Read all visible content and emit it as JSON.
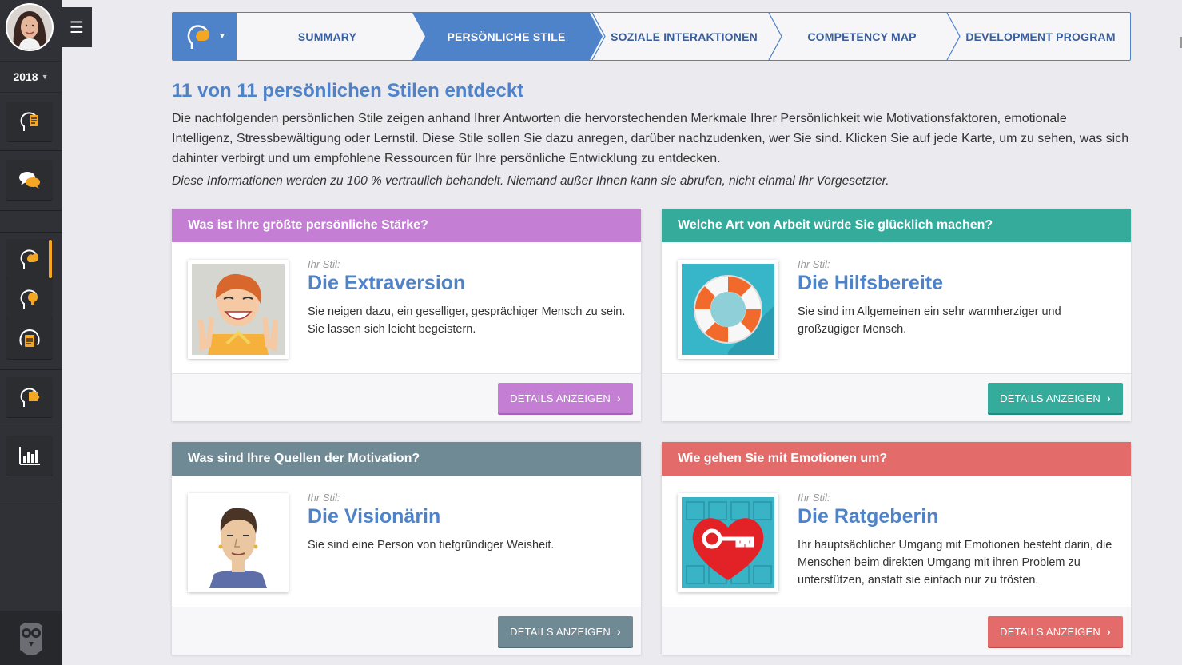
{
  "sidebar": {
    "year": "2018",
    "icons": [
      "head-document-icon",
      "chat-bubbles-icon",
      "head-strength-icon",
      "head-lightbulb-icon",
      "head-clipboard-icon",
      "head-puzzle-icon",
      "bar-chart-icon"
    ],
    "accent_color": "#f5a623"
  },
  "nav": {
    "steps": [
      {
        "label": "SUMMARY"
      },
      {
        "label": "PERSÖNLICHE STILE"
      },
      {
        "label": "SOZIALE INTERAKTIONEN"
      },
      {
        "label": "COMPETENCY MAP"
      },
      {
        "label": "DEVELOPMENT PROGRAM"
      }
    ],
    "active_color": "#4e82c9"
  },
  "intro": {
    "heading": "11 von 11 persönlichen Stilen entdeckt",
    "paragraph": "Die nachfolgenden persönlichen Stile zeigen anhand Ihrer Antworten die hervorstechenden Merkmale Ihrer Persönlichkeit wie Motivationsfaktoren, emotionale Intelligenz, Stressbewältigung oder Lernstil. Diese Stile sollen Sie dazu anregen, darüber nachzudenken, wer Sie sind. Klicken Sie auf jede Karte, um zu sehen, was sich dahinter verbirgt und um empfohlene Ressourcen für Ihre persönliche Entwicklung zu entdecken.",
    "note": "Diese Informationen werden zu 100 % vertraulich behandelt. Niemand außer Ihnen kann sie abrufen, nicht einmal Ihr Vorgesetzter."
  },
  "cards": [
    {
      "question": "Was ist Ihre größte persönliche Stärke?",
      "label": "Ihr Stil:",
      "title": "Die Extraversion",
      "description": "Sie neigen dazu, ein geselliger, gesprächiger Mensch zu sein. Sie lassen sich leicht begeistern.",
      "button": "DETAILS ANZEIGEN",
      "color": "#c47fd5"
    },
    {
      "question": "Welche Art von Arbeit würde Sie glücklich machen?",
      "label": "Ihr Stil:",
      "title": "Die Hilfsbereite",
      "description": "Sie sind im Allgemeinen ein sehr warmherziger und großzügiger Mensch.",
      "button": "DETAILS ANZEIGEN",
      "color": "#35ab9c"
    },
    {
      "question": "Was sind Ihre Quellen der Motivation?",
      "label": "Ihr Stil:",
      "title": "Die Visionärin",
      "description": "Sie sind eine Person von tiefgründiger Weisheit.",
      "button": "DETAILS ANZEIGEN",
      "color": "#6f8a95"
    },
    {
      "question": "Wie gehen Sie mit Emotionen um?",
      "label": "Ihr Stil:",
      "title": "Die Ratgeberin",
      "description": "Ihr hauptsächlicher Umgang mit Emotionen besteht darin, die Menschen beim direkten Umgang mit ihren Problem zu unterstützen, anstatt sie einfach nur zu trösten.",
      "button": "DETAILS ANZEIGEN",
      "color": "#e36c6a"
    }
  ]
}
